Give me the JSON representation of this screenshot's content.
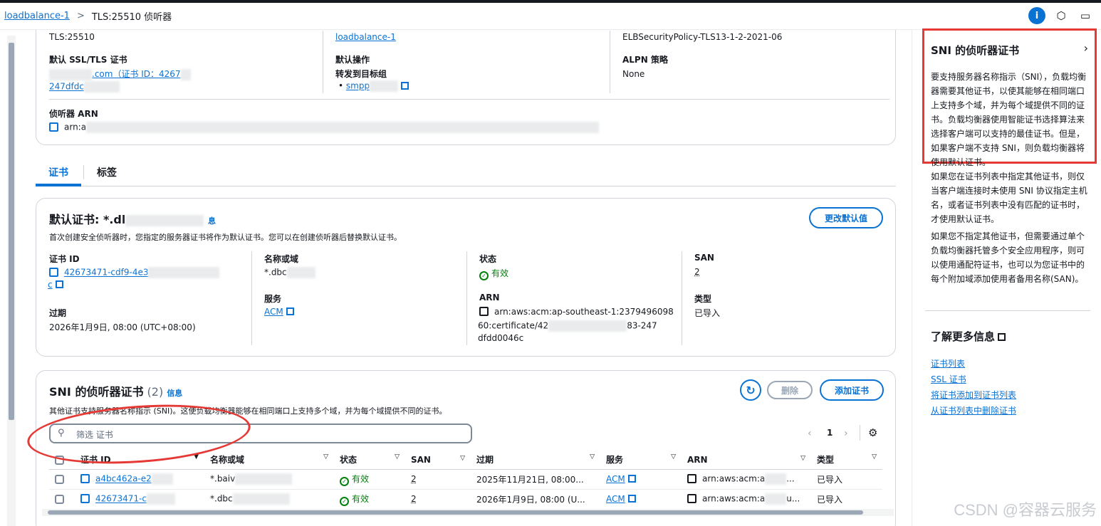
{
  "header": {
    "breadcrumb_root": "loadbalance-1",
    "breadcrumb_sep": ">",
    "breadcrumb_current": "TLS:25510 侦听器",
    "info_icon_label": "i"
  },
  "details": {
    "protocol_value": "TLS:25510",
    "lb_link": "loadbalance-1",
    "security_policy": "ELBSecurityPolicy-TLS13-1-2-2021-06",
    "default_cert_label": "默认 SSL/TLS 证书",
    "default_cert_value": ".com（证书 ID：4267",
    "default_cert_value2": "247dfdc",
    "default_action_label": "默认操作",
    "default_action_value": "转发到目标组",
    "target_group": "smpp",
    "alpn_label": "ALPN 策略",
    "alpn_value": "None",
    "arn_label": "侦听器 ARN",
    "arn_value": "arn:a"
  },
  "tabs": [
    {
      "label": "证书"
    },
    {
      "label": "标签"
    }
  ],
  "default_cert": {
    "title": "默认证书: *.dl",
    "info": "息",
    "change_btn": "更改默认值",
    "desc": "首次创建安全侦听器时，您指定的服务器证书将作为默认证书。您可以在创建侦听器后替换默认证书。",
    "cert_id_label": "证书 ID",
    "cert_id_value": "42673471-cdf9-4e3",
    "cert_id_tail": "c",
    "domain_label": "名称或域",
    "domain_value": "*.dbc",
    "status_label": "状态",
    "status_value": "有效",
    "san_label": "SAN",
    "san_value": "2",
    "service_label": "服务",
    "service_value": "ACM",
    "arn_label": "ARN",
    "arn_line1": "arn:aws:acm:ap-southeast-1:2379496098",
    "arn_line2": "60:certificate/42",
    "arn_line2_tail": "83-247",
    "arn_line3": "dfdd0046c",
    "type_label": "类型",
    "type_value": "已导入",
    "expiry_label": "过期",
    "expiry_value": "2026年1月9日, 08:00 (UTC+08:00)"
  },
  "sni": {
    "title": "SNI 的侦听器证书",
    "count": "(2)",
    "info": "信息",
    "desc": "其他证书支持服务器名称指示 (SNI)。这使负载均衡器能够在相同端口上支持多个域，并为每个域提供不同的证书。",
    "delete_btn": "删除",
    "add_btn": "添加证书",
    "search_placeholder": "筛选 证书",
    "page": "1",
    "columns": [
      "证书 ID",
      "名称或域",
      "状态",
      "SAN",
      "过期",
      "服务",
      "ARN",
      "类型"
    ],
    "rows": [
      {
        "id": "a4bc462a-e2",
        "domain": "*.baiv",
        "status": "有效",
        "san": "2",
        "expiry": "2025年11月21日, 08:00...",
        "service": "ACM",
        "arn": "arn:aws:acm:a",
        "arn_tail": "...",
        "type": "已导入"
      },
      {
        "id": "42673471-c",
        "domain": "*.dbc",
        "status": "有效",
        "san": "2",
        "expiry": "2026年1月9日, 08:00 (U...",
        "service": "ACM",
        "arn": "arn:aws:acm:a",
        "arn_tail": "u...",
        "type": "已导入"
      }
    ]
  },
  "help_panel": {
    "title": "SNI 的侦听器证书",
    "p1": "要支持服务器名称指示（SNI），负载均衡器需要其他证书，以使其能够在相同端口上支持多个域，并为每个域提供不同的证书。负载均衡器使用智能证书选择算法来选择客户端可以支持的最佳证书。但是，如果客户端不支持 SNI，则负载均衡器将使用默认证书。",
    "p2": "如果您在证书列表中指定其他证书，则仅当客户端连接时未使用 SNI 协议指定主机名，或者证书列表中没有匹配的证书时，才使用默认证书。",
    "p3": "如果您不指定其他证书，但需要通过单个负载均衡器托管多个安全应用程序，则可以使用通配符证书，也可以为您证书中的每个附加域添加使用者备用名称(SAN)。",
    "learn_more": "了解更多信息",
    "links": [
      "证书列表",
      "SSL 证书",
      "将证书添加到证书列表",
      "从证书列表中删除证书"
    ]
  },
  "watermark": "CSDN @容器云服务"
}
